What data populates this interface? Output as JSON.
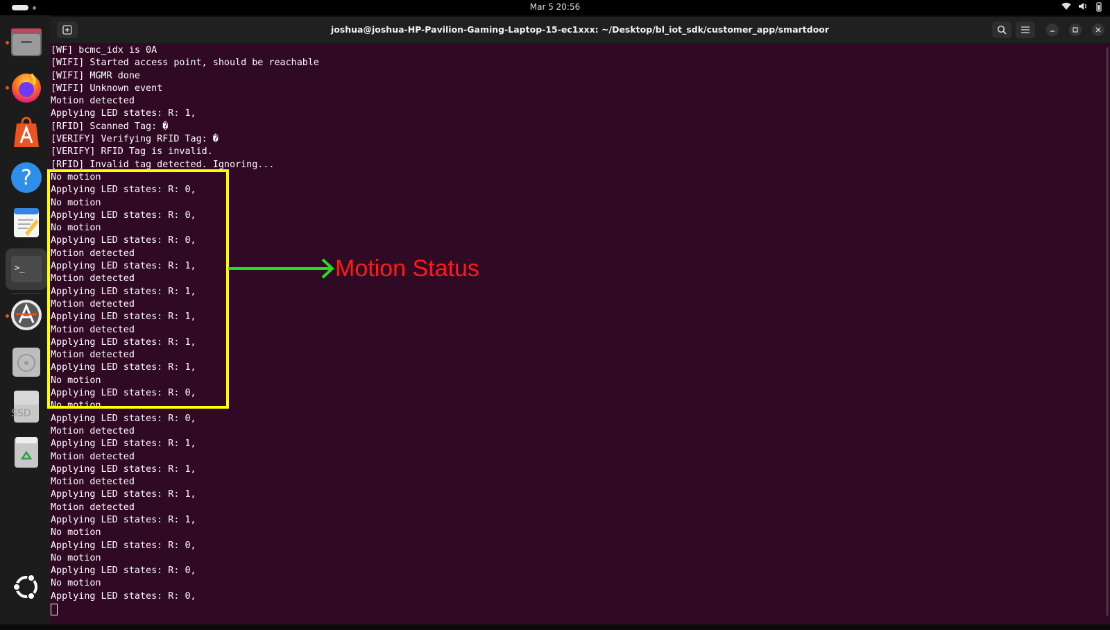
{
  "topbar": {
    "clock": "Mar 5  20:56",
    "icons": [
      "wifi-icon",
      "volume-icon",
      "battery-icon"
    ]
  },
  "dock": {
    "apps": [
      {
        "name": "files",
        "icon": "folder-icon",
        "running": true
      },
      {
        "name": "firefox",
        "icon": "firefox-icon",
        "running": true
      },
      {
        "name": "app-center",
        "icon": "app-center-icon",
        "running": false
      },
      {
        "name": "help",
        "icon": "help-icon",
        "running": false
      },
      {
        "name": "text-editor",
        "icon": "text-editor-icon",
        "running": false
      },
      {
        "name": "terminal",
        "icon": "terminal-icon",
        "running": true,
        "active": true
      },
      {
        "name": "software-updater",
        "icon": "updater-icon",
        "running": true
      },
      {
        "name": "disc",
        "icon": "disc-icon",
        "running": false
      },
      {
        "name": "ssd",
        "icon": "ssd-drive-icon",
        "label": "SSD",
        "running": false
      },
      {
        "name": "trash",
        "icon": "trash-icon",
        "running": false
      },
      {
        "name": "show-apps",
        "icon": "ubuntu-logo-icon",
        "running": false
      }
    ]
  },
  "window": {
    "title": "joshua@joshua-HP-Pavilion-Gaming-Laptop-15-ec1xxx: ~/Desktop/bl_iot_sdk/customer_app/smartdoor",
    "buttons": [
      "search-icon",
      "menu-icon",
      "minimize-icon",
      "maximize-icon",
      "close-icon"
    ]
  },
  "terminal": {
    "lines": [
      "[WF] bcmc_idx is 0A",
      "[WIFI] Started access point, should be reachable",
      "[WIFI] MGMR done",
      "[WIFI] Unknown event",
      "Motion detected",
      "Applying LED states: R: 1,",
      "[RFID] Scanned Tag: �",
      "[VERIFY] Verifying RFID Tag: �",
      "[VERIFY] RFID Tag is invalid.",
      "[RFID] Invalid tag detected. Ignoring...",
      "No motion",
      "Applying LED states: R: 0,",
      "No motion",
      "Applying LED states: R: 0,",
      "No motion",
      "Applying LED states: R: 0,",
      "Motion detected",
      "Applying LED states: R: 1,",
      "Motion detected",
      "Applying LED states: R: 1,",
      "Motion detected",
      "Applying LED states: R: 1,",
      "Motion detected",
      "Applying LED states: R: 1,",
      "Motion detected",
      "Applying LED states: R: 1,",
      "No motion",
      "Applying LED states: R: 0,",
      "No motion",
      "Applying LED states: R: 0,",
      "Motion detected",
      "Applying LED states: R: 1,",
      "Motion detected",
      "Applying LED states: R: 1,",
      "Motion detected",
      "Applying LED states: R: 1,",
      "Motion detected",
      "Applying LED states: R: 1,",
      "No motion",
      "Applying LED states: R: 0,",
      "No motion",
      "Applying LED states: R: 0,",
      "No motion",
      "Applying LED states: R: 0,"
    ]
  },
  "annotation": {
    "label": "Motion Status",
    "box_color": "#ffff00",
    "arrow_color": "#22dd22",
    "label_color": "#ff1a1a"
  },
  "colors": {
    "terminal_bg": "#300a24",
    "titlebar_bg": "#202020",
    "dock_bg": "#1c1c1c",
    "accent": "#e95420"
  }
}
